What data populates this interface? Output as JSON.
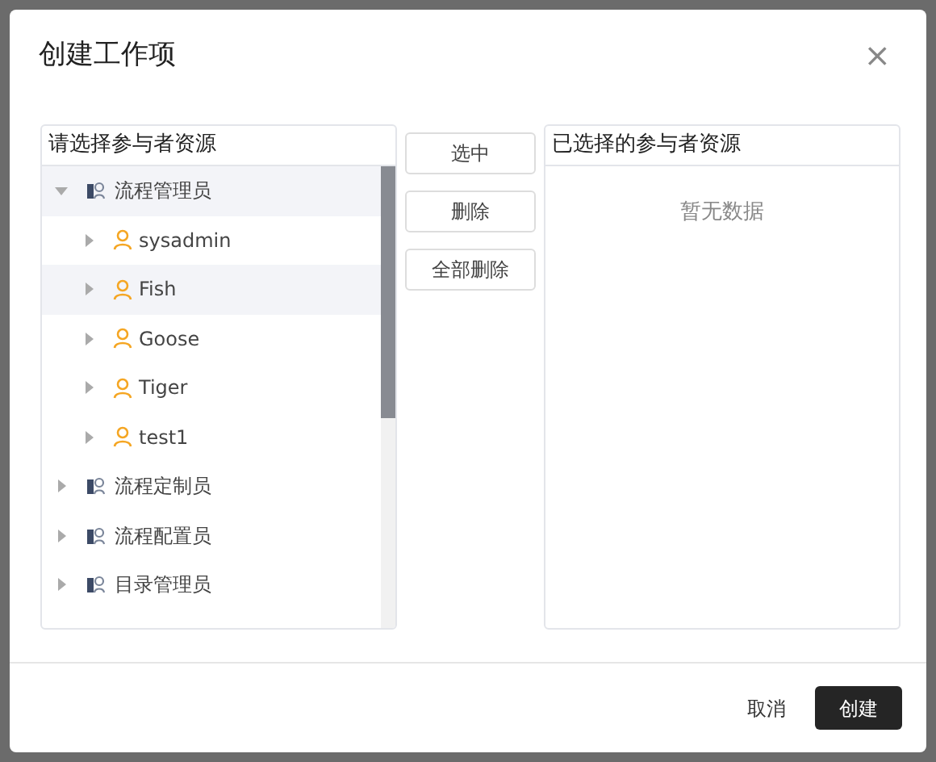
{
  "dialog": {
    "title": "创建工作项",
    "close": "×"
  },
  "source_panel": {
    "title": "请选择参与者资源",
    "tree": [
      {
        "label": "流程管理员",
        "kind": "group",
        "expanded": true,
        "selected": true,
        "children": [
          {
            "label": "sysadmin",
            "kind": "user",
            "expanded": false,
            "selected": false
          },
          {
            "label": "Fish",
            "kind": "user",
            "expanded": false,
            "selected": true
          },
          {
            "label": "Goose",
            "kind": "user",
            "expanded": false,
            "selected": false
          },
          {
            "label": "Tiger",
            "kind": "user",
            "expanded": false,
            "selected": false
          },
          {
            "label": "test1",
            "kind": "user",
            "expanded": false,
            "selected": false
          }
        ]
      },
      {
        "label": "流程定制员",
        "kind": "group",
        "expanded": false,
        "selected": false
      },
      {
        "label": "流程配置员",
        "kind": "group",
        "expanded": false,
        "selected": false
      },
      {
        "label": "目录管理员",
        "kind": "group",
        "expanded": false,
        "selected": false
      }
    ]
  },
  "transfer_buttons": [
    "选中",
    "删除",
    "全部删除"
  ],
  "target_panel": {
    "title": "已选择的参与者资源",
    "empty_text": "暂无数据"
  },
  "footer": {
    "cancel": "取消",
    "confirm": "创建"
  }
}
